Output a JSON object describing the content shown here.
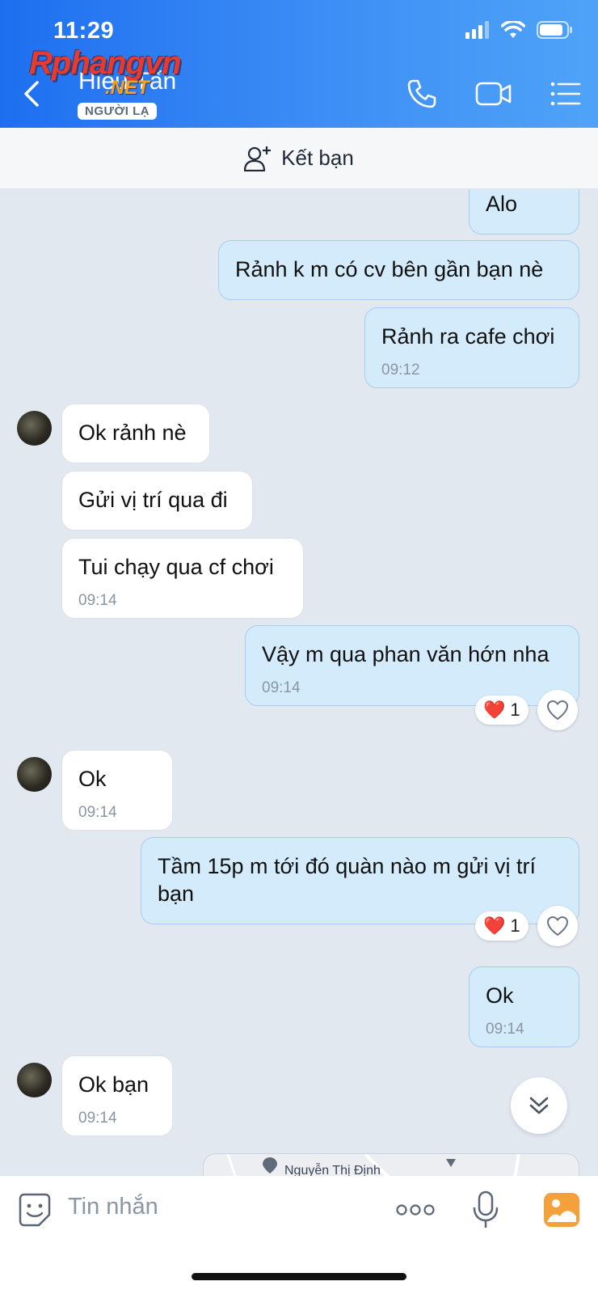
{
  "status_bar": {
    "time": "11:29"
  },
  "header": {
    "contact_name": "Hiếu Tấn",
    "badge": "NGƯỜI LẠ",
    "watermark_main": "Rphangvn",
    "watermark_sub": ".NET",
    "icons": [
      "back-chevron-icon",
      "phone-icon",
      "video-call-icon",
      "menu-list-icon"
    ]
  },
  "friend_bar": {
    "label": "Kết bạn",
    "icon": "add-user-icon"
  },
  "messages": [
    {
      "dir": "out",
      "text": "Alo",
      "time": ""
    },
    {
      "dir": "out",
      "text": "Rảnh k m có cv bên gần bạn nè",
      "time": ""
    },
    {
      "dir": "out",
      "text": "Rảnh ra cafe chơi",
      "time": "09:12"
    },
    {
      "dir": "in",
      "text": "Ok rảnh nè",
      "time": ""
    },
    {
      "dir": "in",
      "text": "Gửi vị trí qua đi",
      "time": ""
    },
    {
      "dir": "in",
      "text": "Tui chạy qua cf chơi",
      "time": "09:14"
    },
    {
      "dir": "out",
      "text": "Vậy m qua phan văn hớn nha",
      "time": "09:14",
      "reaction": {
        "emoji": "❤️",
        "count": "1"
      }
    },
    {
      "dir": "in",
      "text": "Ok",
      "time": "09:14"
    },
    {
      "dir": "out",
      "text": "Tầm 15p m tới đó quàn nào m gửi vị trí bạn",
      "time": "",
      "reaction": {
        "emoji": "❤️",
        "count": "1"
      }
    },
    {
      "dir": "out",
      "text": "Ok",
      "time": "09:14"
    },
    {
      "dir": "in",
      "text": "Ok bạn",
      "time": "09:14"
    }
  ],
  "map_preview": {
    "street_label": "Nguyễn Thị Định"
  },
  "input_bar": {
    "placeholder": "Tin nhắn",
    "icons": [
      "sticker-icon",
      "more-dots-icon",
      "microphone-icon",
      "image-gallery-icon"
    ]
  },
  "colors": {
    "header_start": "#1e6ff0",
    "header_end": "#4fa3f7",
    "out_bubble": "#d4ebfb",
    "in_bubble": "#ffffff",
    "chat_bg": "#e2e8f0"
  }
}
